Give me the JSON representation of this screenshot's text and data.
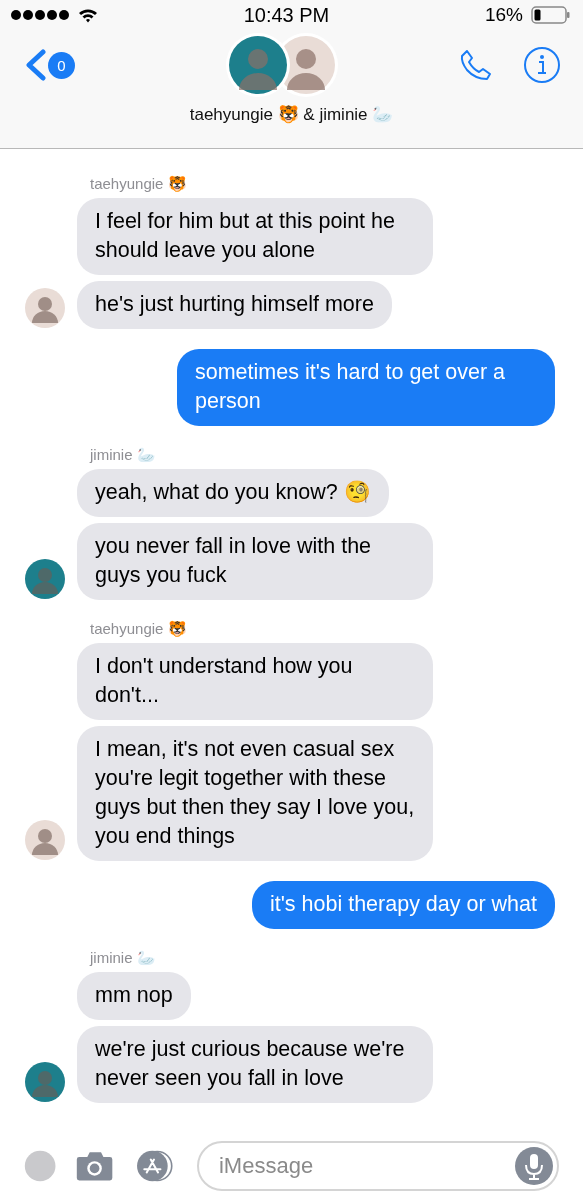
{
  "status_bar": {
    "time": "10:43 PM",
    "battery": "16%"
  },
  "header": {
    "back_badge": "0",
    "title": "taehyungie 🐯 & jiminie 🦢",
    "avatars": [
      {
        "color": "#1d7f8c"
      },
      {
        "color": "#e9dcd6"
      }
    ]
  },
  "messages": [
    {
      "kind": "incoming",
      "sender": "taehyungie 🐯",
      "color": "#e9dcd6",
      "texts": [
        "I feel for him but at this point he should leave you alone",
        "he's just hurting himself more"
      ]
    },
    {
      "kind": "outgoing",
      "texts": [
        "sometimes it's hard to get over a person"
      ]
    },
    {
      "kind": "incoming",
      "sender": "jiminie 🦢",
      "color": "#1d7f8c",
      "texts": [
        "yeah, what do you know? 🧐",
        "you never fall in love with the guys you fuck"
      ]
    },
    {
      "kind": "incoming",
      "sender": "taehyungie 🐯",
      "color": "#e9dcd6",
      "texts": [
        "I don't understand how you don't...",
        "I mean, it's not even casual sex you're legit together with these guys but then they say I love you, you end things"
      ]
    },
    {
      "kind": "outgoing",
      "texts": [
        "it's hobi therapy day or what"
      ]
    },
    {
      "kind": "incoming",
      "sender": "jiminie 🦢",
      "color": "#1d7f8c",
      "texts": [
        "mm nop",
        "we're just curious because we're never seen you fall in love"
      ]
    }
  ],
  "composer": {
    "placeholder": "iMessage"
  }
}
